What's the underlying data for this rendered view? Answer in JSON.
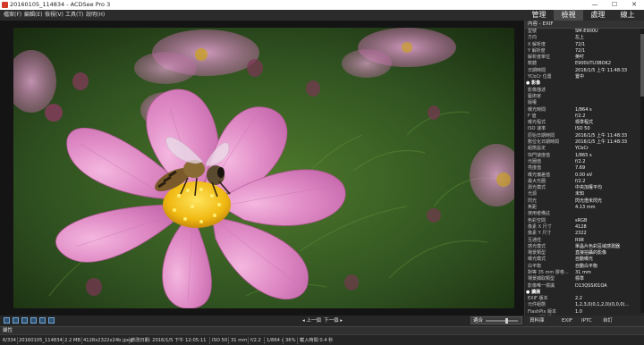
{
  "window": {
    "title": "20160105_114834 - ACDSee Pro 3",
    "controls": [
      "—",
      "☐",
      "✕"
    ]
  },
  "menu": [
    "檔案(F)",
    "編輯(E)",
    "檢視(V)",
    "工具(T)",
    "說明(H)"
  ],
  "modes": [
    {
      "label": "管理",
      "active": false
    },
    {
      "label": "檢視",
      "active": true
    },
    {
      "label": "處理",
      "active": false
    },
    {
      "label": "線上",
      "active": false
    }
  ],
  "properties_panel": {
    "header": "內容 - EXIF",
    "rows": [
      {
        "k": "型號",
        "v": "SM-E900U"
      },
      {
        "k": "方向",
        "v": "左上"
      },
      {
        "k": "X 解析度",
        "v": "72/1"
      },
      {
        "k": "Y 解析度",
        "v": "72/1"
      },
      {
        "k": "解析度單位",
        "v": "英吋"
      },
      {
        "k": "軟體",
        "v": "E900UTU3BOK2"
      },
      {
        "k": "日期時間",
        "v": "2016/1/5 上午 11:48:33"
      },
      {
        "k": "YCbCr 位置",
        "v": "置中"
      },
      {
        "k": "● 影像",
        "v": "",
        "section": true
      },
      {
        "k": "影像描述",
        "v": ""
      },
      {
        "k": "藝術家",
        "v": ""
      },
      {
        "k": "版權",
        "v": ""
      },
      {
        "k": "曝光時間",
        "v": "1/864 s"
      },
      {
        "k": "F 值",
        "v": "f/2.2"
      },
      {
        "k": "曝光程式",
        "v": "標準程式"
      },
      {
        "k": "ISO 速率",
        "v": "ISO 50"
      },
      {
        "k": "原始日期時間",
        "v": "2016/1/5 上午 11:48:33"
      },
      {
        "k": "數位化日期時間",
        "v": "2016/1/5 上午 11:48:33"
      },
      {
        "k": "組態設定",
        "v": "YCbCr"
      },
      {
        "k": "快門速度值",
        "v": "1/865 s"
      },
      {
        "k": "光圈值",
        "v": "f/2.2"
      },
      {
        "k": "亮度值",
        "v": "7.69"
      },
      {
        "k": "曝光偏差值",
        "v": "0.00 eV"
      },
      {
        "k": "最大光圈",
        "v": "f/2.2"
      },
      {
        "k": "測光模式",
        "v": "中央加權平均"
      },
      {
        "k": "光源",
        "v": "未知"
      },
      {
        "k": "閃光",
        "v": "閃光燈未閃光"
      },
      {
        "k": "焦距",
        "v": "4.13 mm"
      },
      {
        "k": "使用者備註",
        "v": ""
      },
      {
        "k": "色彩空間",
        "v": "sRGB"
      },
      {
        "k": "像素 X 尺寸",
        "v": "4128"
      },
      {
        "k": "像素 Y 尺寸",
        "v": "2322"
      },
      {
        "k": "互通性",
        "v": "R98"
      },
      {
        "k": "感光模式",
        "v": "單晶片色彩區域感測器"
      },
      {
        "k": "場景類型",
        "v": "直接拍攝的影像"
      },
      {
        "k": "曝光模式",
        "v": "自動曝光"
      },
      {
        "k": "白平衡",
        "v": "自動白平衡"
      },
      {
        "k": "對等 35 mm 膠卷...",
        "v": "31 mm"
      },
      {
        "k": "場景擷取類型",
        "v": "標準"
      },
      {
        "k": "影像唯一標識",
        "v": "D13QSSI01OA"
      },
      {
        "k": "● 擴展",
        "v": "",
        "section": true
      },
      {
        "k": "EXIF 版本",
        "v": "2.2"
      },
      {
        "k": "元件組態",
        "v": "1,2,3,0(0,1,2,0)(0,0,0)..."
      },
      {
        "k": "FlashPix 版本",
        "v": "1.0"
      },
      {
        "k": "GPS 標準版本",
        "v": "2.2.0.0"
      }
    ]
  },
  "panel_tabs": [
    "資料庫",
    "EXIF",
    "IPTC",
    "自訂"
  ],
  "nav": {
    "prev": "◂ 上一個",
    "next": "下一個 ▸"
  },
  "zoom": {
    "label": "適合",
    "level": 0.65
  },
  "info_label": "屬性",
  "status": [
    "6/334",
    "20160105_114834",
    "2.2 MB",
    "4128x2322x24b jpeg",
    "修改日期: 2016/1/5 下午 12:05:11",
    "ISO 50",
    "31 mm",
    "f/2.2",
    "1/864 s",
    "36%",
    "載入時間 0.4 秒"
  ],
  "colors": {
    "petal": "#d979b8",
    "petal_light": "#f0a7d7",
    "pollen": "#f2c51a",
    "foliage": "#2d4c1e"
  }
}
